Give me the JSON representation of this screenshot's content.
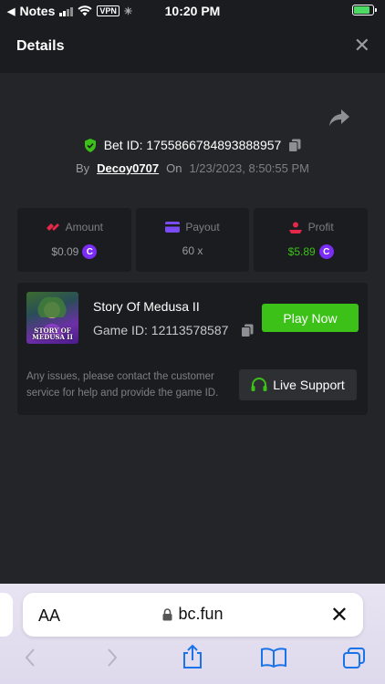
{
  "status_bar": {
    "back_app": "Notes",
    "vpn": "VPN",
    "time": "10:20 PM"
  },
  "header": {
    "title": "Details",
    "close": "✕"
  },
  "bet": {
    "id_text": "Bet ID: 1755866784893888957",
    "by_label": "By",
    "username": "Decoy0707",
    "on_label": "On",
    "date": "1/23/2023, 8:50:55 PM"
  },
  "stats": {
    "amount_label": "Amount",
    "amount_value": "$0.09",
    "payout_label": "Payout",
    "payout_value": "60 x",
    "profit_label": "Profit",
    "profit_value": "$5.89"
  },
  "game": {
    "name": "Story Of Medusa II",
    "id_text": "Game ID: 12113578587",
    "thumb_title_1": "STORY OF",
    "thumb_title_2": "MEDUSA II",
    "play_label": "Play Now",
    "support_text": "Any issues, please contact the customer service for help and provide the game ID.",
    "live_support_label": "Live Support"
  },
  "browser": {
    "aa": "AA",
    "url": "bc.fun",
    "close": "✕"
  },
  "colors": {
    "accent_green": "#3bc117",
    "coin_purple": "#7b2cf5",
    "bg": "#232528",
    "panel": "#1b1c1f"
  }
}
